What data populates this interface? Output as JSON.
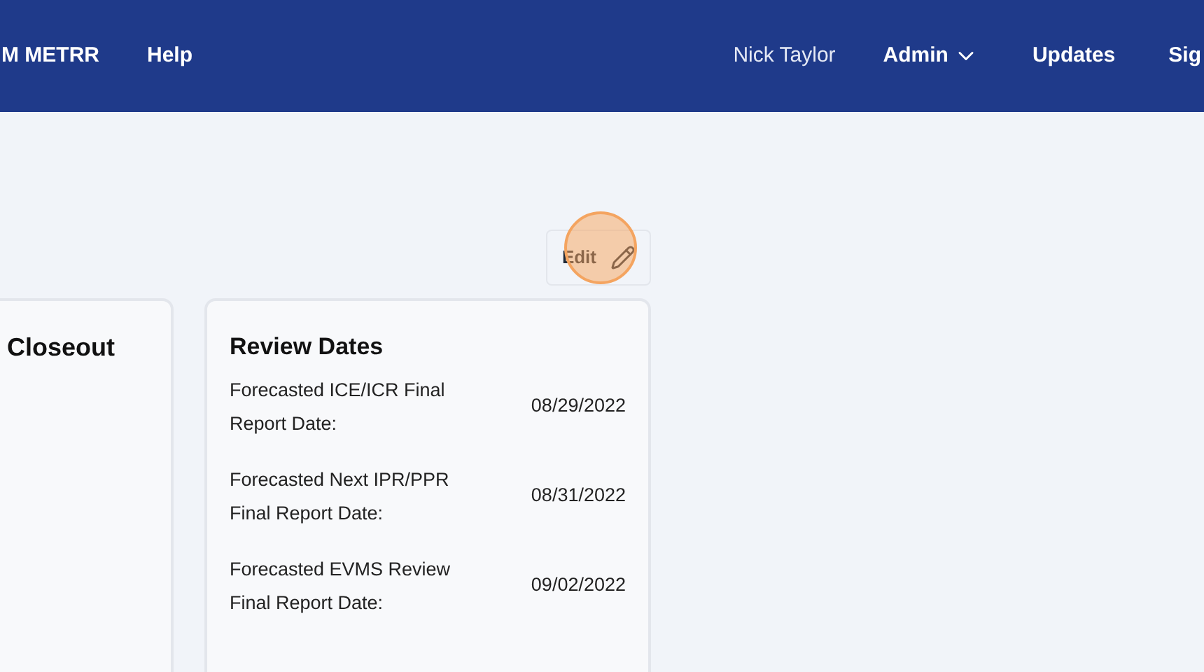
{
  "nav": {
    "left": [
      "M METRR",
      "Help"
    ],
    "user": "Nick Taylor",
    "right": [
      {
        "label": "Admin",
        "kind": "dropdown"
      },
      {
        "label": "Updates",
        "kind": "link"
      },
      {
        "label": "Sig",
        "kind": "link"
      }
    ]
  },
  "edit_button": {
    "label": "Edit"
  },
  "closeout_card": {
    "title": "Closeout"
  },
  "review_card": {
    "title": "Review Dates",
    "rows": [
      {
        "label": "Forecasted ICE/ICR Final Report Date:",
        "value": "08/29/2022"
      },
      {
        "label": "Forecasted Next IPR/PPR Final Report Date:",
        "value": "08/31/2022"
      },
      {
        "label": "Forecasted EVMS Review Final Report Date:",
        "value": "09/02/2022"
      }
    ]
  }
}
